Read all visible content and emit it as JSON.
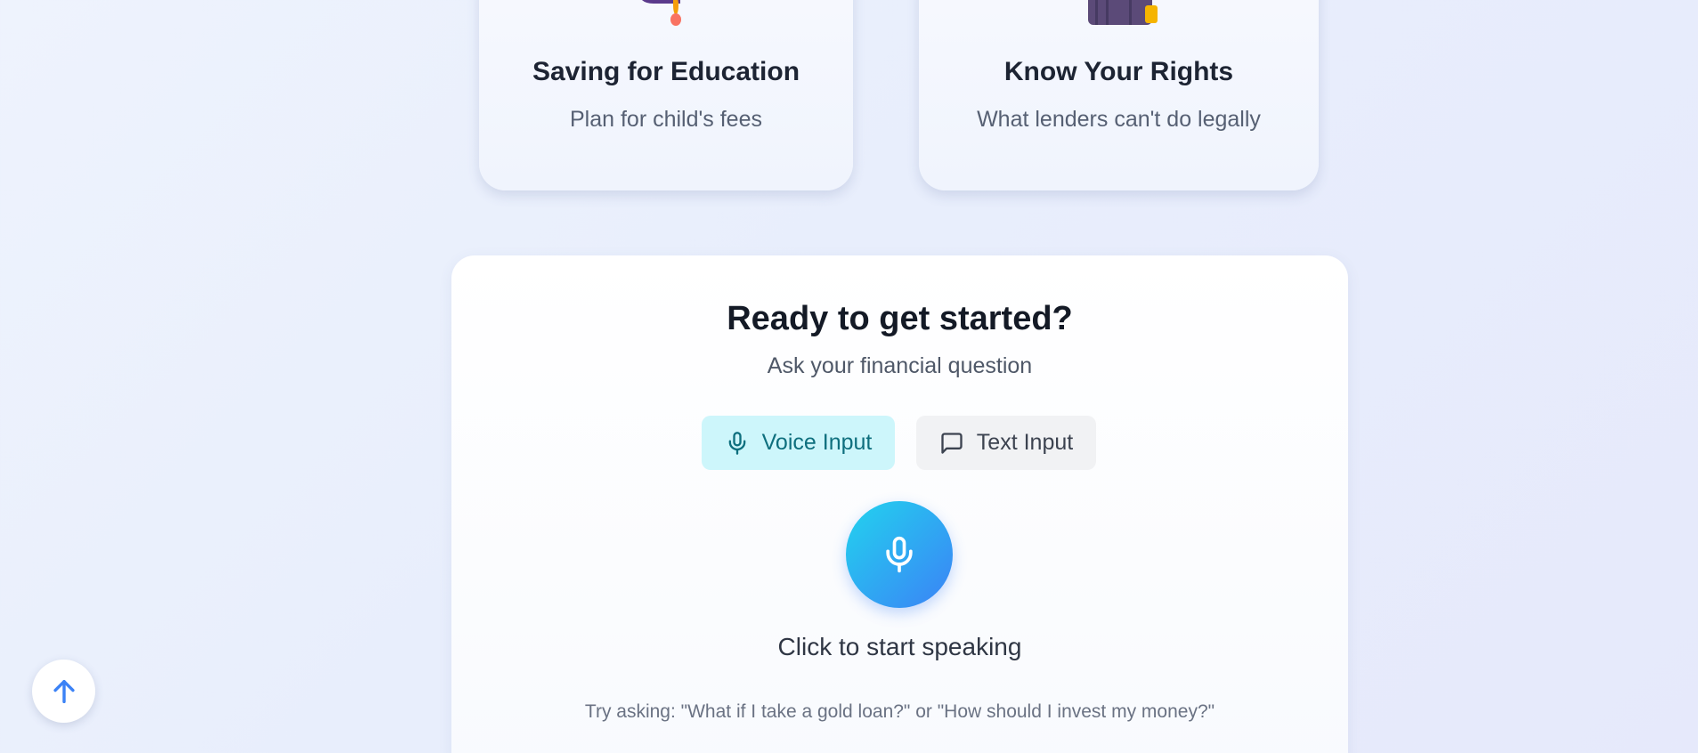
{
  "topics": [
    {
      "title": "Saving for Education",
      "subtitle": "Plan for child's fees",
      "icon": "graduation-illustration-icon"
    },
    {
      "title": "Know Your Rights",
      "subtitle": "What lenders can't do legally",
      "icon": "judge-illustration-icon"
    }
  ],
  "panel": {
    "title": "Ready to get started?",
    "subtitle": "Ask your financial question",
    "modes": [
      {
        "label": "Voice Input",
        "icon": "microphone-icon",
        "active": true
      },
      {
        "label": "Text Input",
        "icon": "chat-bubble-icon",
        "active": false
      }
    ],
    "mic_hint": "Click to start speaking",
    "try_text": "Try asking: \"What if I take a gold loan?\" or \"How should I invest my money?\""
  },
  "scroll_top": {
    "icon": "arrow-up-icon"
  },
  "colors": {
    "accent_cyan": "#22d3ee",
    "accent_blue": "#3b82f6",
    "voice_active_bg": "#cdf6fb",
    "voice_active_text": "#0e6f7e"
  }
}
